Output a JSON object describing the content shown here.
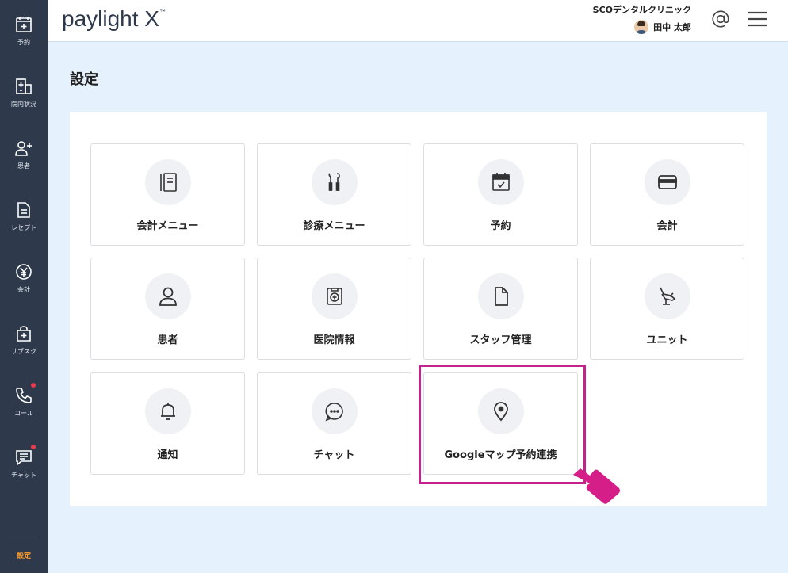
{
  "sidebar": {
    "items": [
      {
        "label": "予約",
        "icon": "calendar-plus-icon"
      },
      {
        "label": "院内状況",
        "icon": "building-icon"
      },
      {
        "label": "患者",
        "icon": "user-plus-icon"
      },
      {
        "label": "レセプト",
        "icon": "document-icon"
      },
      {
        "label": "会計",
        "icon": "yen-icon"
      },
      {
        "label": "サブスク",
        "icon": "bag-plus-icon"
      },
      {
        "label": "コール",
        "icon": "phone-icon"
      },
      {
        "label": "チャット",
        "icon": "chat-icon"
      }
    ],
    "settings_label": "設定"
  },
  "header": {
    "logo": "paylight X",
    "logo_mark": "™",
    "clinic_name": "SCOデンタルクリニック",
    "user_name": "田中 太郎"
  },
  "page": {
    "title": "設定"
  },
  "cards": [
    {
      "label": "会計メニュー",
      "icon": "notebook-icon"
    },
    {
      "label": "診療メニュー",
      "icon": "dental-tools-icon"
    },
    {
      "label": "予約",
      "icon": "calendar-check-icon"
    },
    {
      "label": "会計",
      "icon": "credit-card-icon"
    },
    {
      "label": "患者",
      "icon": "person-icon"
    },
    {
      "label": "医院情報",
      "icon": "medical-cross-icon"
    },
    {
      "label": "スタッフ管理",
      "icon": "file-icon"
    },
    {
      "label": "ユニット",
      "icon": "dental-chair-icon"
    },
    {
      "label": "通知",
      "icon": "bell-icon"
    },
    {
      "label": "チャット",
      "icon": "chat-bubble-icon"
    },
    {
      "label": "Googleマップ予約連携",
      "icon": "map-pin-icon"
    }
  ],
  "colors": {
    "sidebar_bg": "#2e3a4c",
    "page_bg": "#e5f1fc",
    "settings_active": "#ff9f2e",
    "highlight": "#c4248a",
    "notification_dot": "#f0374b"
  }
}
